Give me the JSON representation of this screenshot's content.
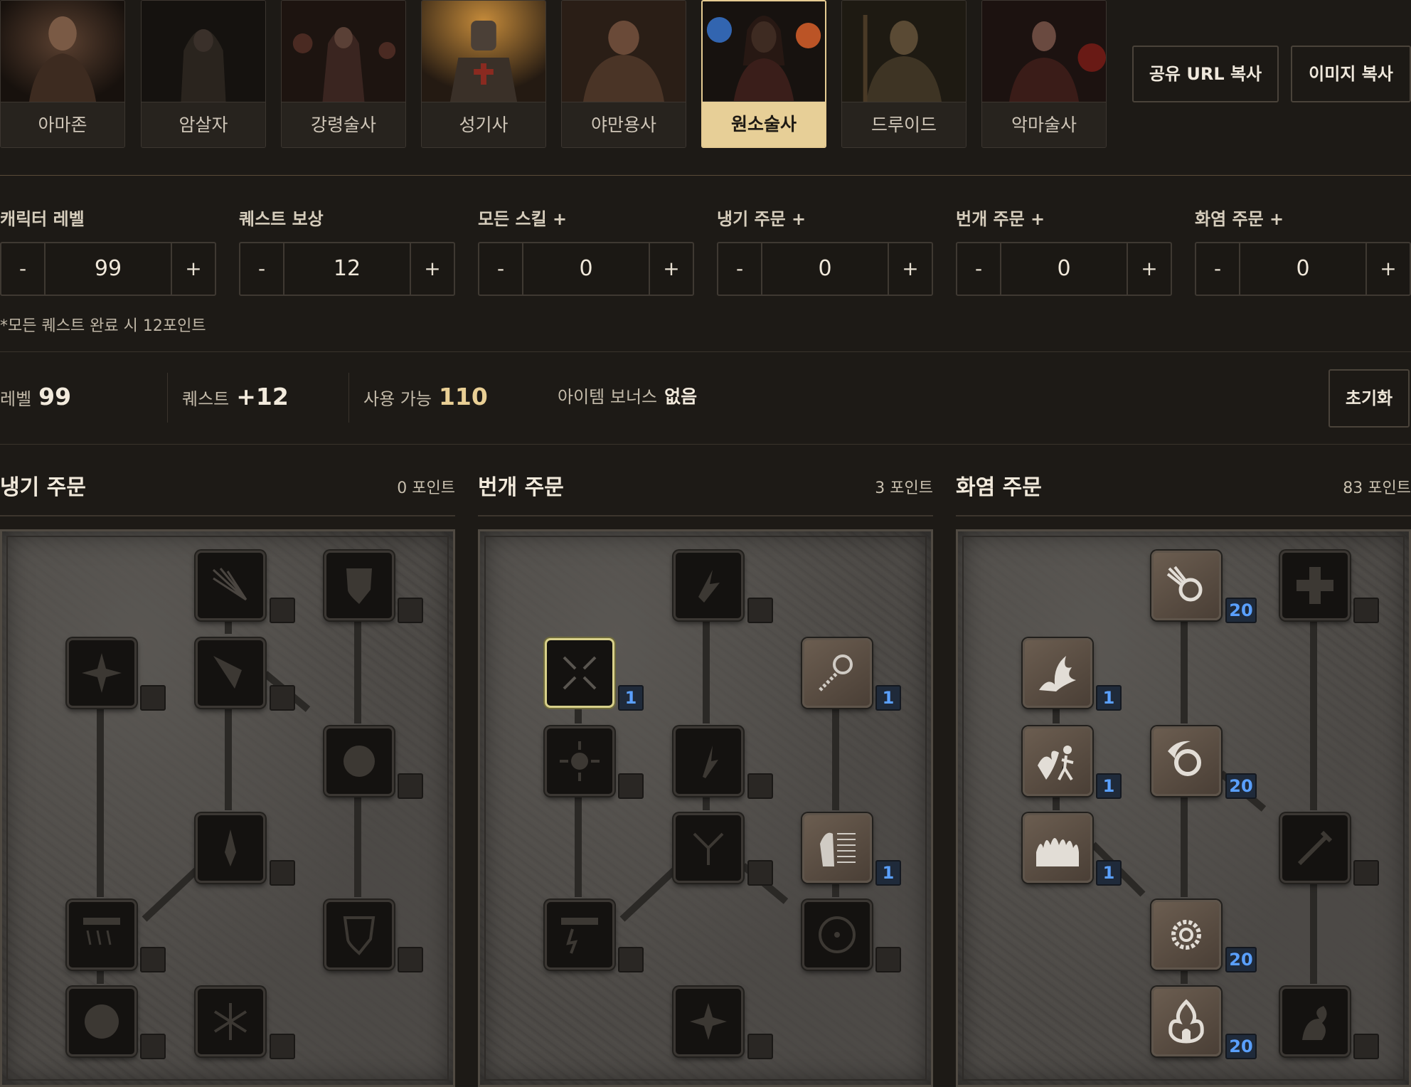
{
  "classes": [
    {
      "name": "아마존",
      "selected": false
    },
    {
      "name": "암살자",
      "selected": false
    },
    {
      "name": "강령술사",
      "selected": false
    },
    {
      "name": "성기사",
      "selected": false
    },
    {
      "name": "야만용사",
      "selected": false
    },
    {
      "name": "원소술사",
      "selected": true
    },
    {
      "name": "드루이드",
      "selected": false
    },
    {
      "name": "악마술사",
      "selected": false
    }
  ],
  "actions": {
    "share_url": "공유 URL 복사",
    "copy_image": "이미지 복사",
    "reset": "초기화"
  },
  "steppers": [
    {
      "label": "캐릭터 레벨",
      "value": "99"
    },
    {
      "label": "퀘스트 보상",
      "value": "12"
    },
    {
      "label": "모든 스킬 +",
      "value": "0"
    },
    {
      "label": "냉기 주문 +",
      "value": "0"
    },
    {
      "label": "번개 주문 +",
      "value": "0"
    },
    {
      "label": "화염 주문 +",
      "value": "0"
    }
  ],
  "stepper_minus": "-",
  "stepper_plus": "+",
  "quest_note": "*모든 퀘스트 완료 시 12포인트",
  "summary": {
    "level_label": "레벨",
    "level_value": "99",
    "quest_label": "퀘스트",
    "quest_value": "+12",
    "available_label": "사용 가능",
    "available_value": "110",
    "item_bonus_label": "아이템 보너스",
    "item_bonus_value": "없음"
  },
  "trees": [
    {
      "title": "냉기 주문",
      "points": "0 포인트",
      "skills": [
        {
          "icon": "ice-bolt-icon",
          "points": "0"
        },
        {
          "icon": "frozen-armor-icon",
          "points": "0"
        },
        {
          "icon": "frost-nova-icon",
          "points": "0"
        },
        {
          "icon": "ice-blast-icon",
          "points": "0"
        },
        {
          "icon": "shiver-armor-icon",
          "points": "0"
        },
        {
          "icon": "glacial-spike-icon",
          "points": "0"
        },
        {
          "icon": "blizzard-icon",
          "points": "0"
        },
        {
          "icon": "chilling-armor-icon",
          "points": "0"
        },
        {
          "icon": "frozen-orb-icon",
          "points": "0"
        },
        {
          "icon": "cold-mastery-icon",
          "points": "0"
        }
      ]
    },
    {
      "title": "번개 주문",
      "points": "3 포인트",
      "skills": [
        {
          "icon": "charged-bolt-icon",
          "points": "0"
        },
        {
          "icon": "static-field-icon",
          "points": "1"
        },
        {
          "icon": "telekinesis-icon",
          "points": "1"
        },
        {
          "icon": "nova-icon",
          "points": "0"
        },
        {
          "icon": "lightning-icon",
          "points": "0"
        },
        {
          "icon": "chain-lightning-icon",
          "points": "0"
        },
        {
          "icon": "teleport-icon",
          "points": "1"
        },
        {
          "icon": "thunder-storm-icon",
          "points": "0"
        },
        {
          "icon": "energy-shield-icon",
          "points": "0"
        },
        {
          "icon": "lightning-mastery-icon",
          "points": "0"
        }
      ]
    },
    {
      "title": "화염 주문",
      "points": "83 포인트",
      "skills": [
        {
          "icon": "fire-bolt-icon",
          "points": "20"
        },
        {
          "icon": "warmth-icon",
          "points": "0"
        },
        {
          "icon": "inferno-icon",
          "points": "1"
        },
        {
          "icon": "blaze-icon",
          "points": "1"
        },
        {
          "icon": "fire-ball-icon",
          "points": "20"
        },
        {
          "icon": "fire-wall-icon",
          "points": "1"
        },
        {
          "icon": "enchant-icon",
          "points": "0"
        },
        {
          "icon": "meteor-icon",
          "points": "20"
        },
        {
          "icon": "fire-mastery-icon",
          "points": "20"
        },
        {
          "icon": "hydra-icon",
          "points": "0"
        }
      ]
    }
  ],
  "colors": {
    "accent": "#e7cf97",
    "points_blue": "#5aa0ff",
    "background": "#1d1a16"
  }
}
